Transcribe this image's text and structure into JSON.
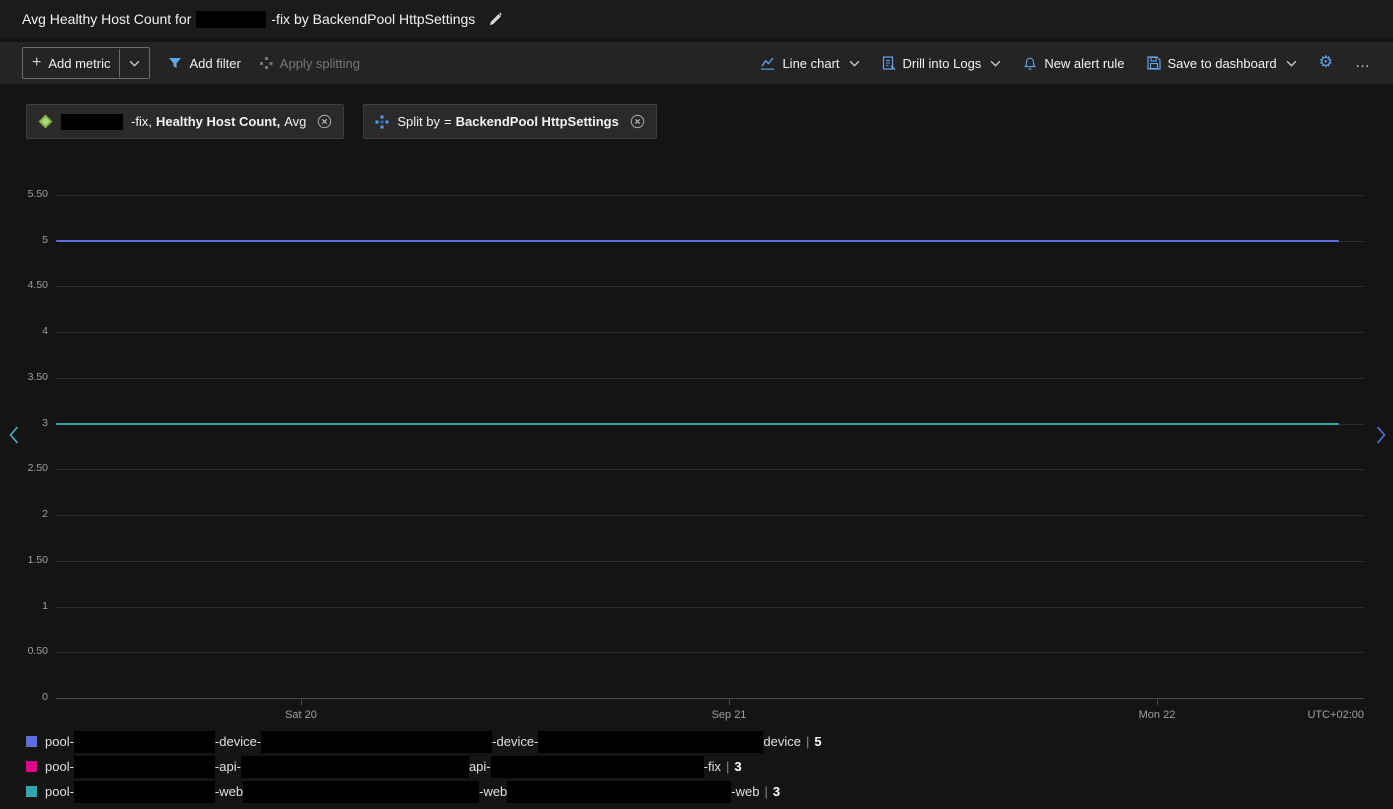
{
  "title": {
    "prefix": "Avg Healthy Host Count for",
    "suffix": "-fix by BackendPool HttpSettings"
  },
  "toolbar": {
    "add_metric": "Add metric",
    "add_filter": "Add filter",
    "apply_splitting": "Apply splitting",
    "line_chart": "Line chart",
    "drill_into_logs": "Drill into Logs",
    "new_alert_rule": "New alert rule",
    "save_to_dashboard": "Save to dashboard"
  },
  "pills": {
    "metric": {
      "resource_suffix": "-fix,",
      "metric_name": "Healthy Host Count,",
      "aggregation": "Avg"
    },
    "split": {
      "label": "Split by",
      "operator": "=",
      "value": "BackendPool HttpSettings"
    }
  },
  "chart_data": {
    "type": "line",
    "title": "Avg Healthy Host Count for -fix by BackendPool HttpSettings",
    "y_ticks": [
      "5.50",
      "5",
      "4.50",
      "4",
      "3.50",
      "3",
      "2.50",
      "2",
      "1.50",
      "1",
      "0.50",
      "0"
    ],
    "ylim": [
      0,
      5.5
    ],
    "x_ticks": [
      "Sat 20",
      "Sep 21",
      "Mon 22"
    ],
    "timezone": "UTC+02:00",
    "grid": true,
    "legend_position": "bottom",
    "series": [
      {
        "name": "pool-[redacted]-device-[redacted]-device-[redacted]device",
        "value": 5,
        "color": "#5b6ee1"
      },
      {
        "name": "pool-[redacted]-api-[redacted]api-[redacted]-fix",
        "value": 3,
        "color": "#e3008c"
      },
      {
        "name": "pool-[redacted]-web[redacted]-web[redacted]-web",
        "value": 3,
        "color": "#2fa7ad"
      }
    ]
  },
  "legend": {
    "separator": "|",
    "items": [
      {
        "color": "#5b6ee1",
        "segments": [
          "pool-",
          "-device-",
          "-device-",
          "device"
        ],
        "value": "5"
      },
      {
        "color": "#e3008c",
        "segments": [
          "pool-",
          "-api-",
          "api-",
          "-fix"
        ],
        "value": "3"
      },
      {
        "color": "#2fa7ad",
        "segments": [
          "pool-",
          "-web",
          "-web",
          "-web"
        ],
        "value": "3"
      }
    ]
  }
}
